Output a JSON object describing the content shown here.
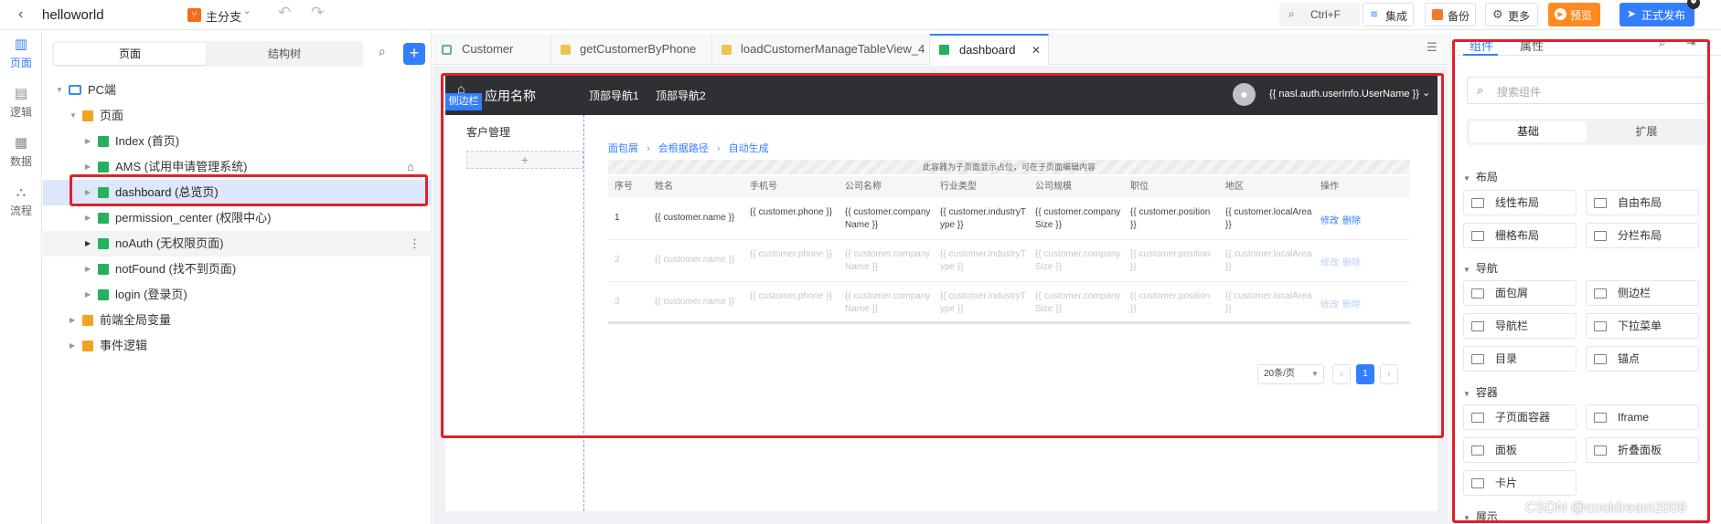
{
  "app": {
    "project_name": "helloworld",
    "branch": "主分支"
  },
  "toolbar": {
    "search_shortcut": "Ctrl+F",
    "integrate": "集成",
    "backup": "备份",
    "more": "更多",
    "preview": "预览",
    "publish": "正式发布"
  },
  "rail": {
    "items": [
      {
        "label": "页面",
        "icon": "page-icon"
      },
      {
        "label": "逻辑",
        "icon": "logic-icon"
      },
      {
        "label": "数据",
        "icon": "data-icon"
      },
      {
        "label": "流程",
        "icon": "flow-icon"
      }
    ]
  },
  "tree_panel": {
    "tabs": [
      "页面",
      "结构树"
    ],
    "nodes": [
      {
        "label": "PC端"
      },
      {
        "label": "页面"
      },
      {
        "label": "Index (首页)"
      },
      {
        "label": "AMS (试用申请管理系统)"
      },
      {
        "label": "dashboard (总览页)"
      },
      {
        "label": "permission_center (权限中心)"
      },
      {
        "label": "noAuth (无权限页面)"
      },
      {
        "label": "notFound (找不到页面)"
      },
      {
        "label": "login (登录页)"
      },
      {
        "label": "前端全局变量"
      },
      {
        "label": "事件逻辑"
      }
    ]
  },
  "editor_tabs": [
    {
      "label": "Customer"
    },
    {
      "label": "getCustomerByPhone"
    },
    {
      "label": "loadCustomerManageTableView_4"
    },
    {
      "label": "dashboard"
    }
  ],
  "canvas": {
    "app_title": "应用名称",
    "sidebar_tag": "侧边栏",
    "top_nav": [
      "顶部导航1",
      "顶部导航2"
    ],
    "username_expr": "{{ nasl.auth.userInfo.UserName }}",
    "side_menu_item": "客户管理",
    "add_symbol": "+",
    "breadcrumb": [
      "面包屑",
      "会根据路径",
      "自动生成"
    ],
    "placeholder_hint": "此容器为子页面显示占位，可在子页面编辑内容",
    "table": {
      "headers": [
        "序号",
        "姓名",
        "手机号",
        "公司名称",
        "行业类型",
        "公司规模",
        "职位",
        "地区",
        "操作"
      ],
      "rows": [
        [
          "1",
          "{{ customer.name }}",
          "{{ customer.phone }}",
          "{{ customer.companyName }}",
          "{{ customer.industryType }}",
          "{{ customer.companySize }}",
          "{{ customer.position }}",
          "{{ customer.localArea }}"
        ],
        [
          "2",
          "{{ customer.name }}",
          "{{ customer.phone }}",
          "{{ customer.companyName }}",
          "{{ customer.industryType }}",
          "{{ customer.companySize }}",
          "{{ customer.position }}",
          "{{ customer.localArea }}"
        ],
        [
          "3",
          "{{ customer.name }}",
          "{{ customer.phone }}",
          "{{ customer.companyName }}",
          "{{ customer.industryType }}",
          "{{ customer.companySize }}",
          "{{ customer.position }}",
          "{{ customer.localArea }}"
        ]
      ],
      "action_edit": "修改",
      "action_delete": "删除"
    },
    "pagination": {
      "page_size": "20条/页",
      "current_page": "1"
    }
  },
  "right_panel": {
    "tabs": [
      "组件",
      "属性"
    ],
    "search_placeholder": "搜索组件",
    "subtabs": [
      "基础",
      "扩展"
    ],
    "sections": [
      {
        "title": "布局",
        "items": [
          "线性布局",
          "自由布局",
          "栅格布局",
          "分栏布局"
        ]
      },
      {
        "title": "导航",
        "items": [
          "面包屑",
          "侧边栏",
          "导航栏",
          "下拉菜单",
          "目录",
          "锚点"
        ]
      },
      {
        "title": "容器",
        "items": [
          "子页面容器",
          "Iframe",
          "面板",
          "折叠面板",
          "卡片"
        ]
      },
      {
        "title": "展示",
        "items": []
      }
    ]
  },
  "watermark": "CSDN @cooldream2009",
  "colors": {
    "accent": "#337eff",
    "highlight": "#e0202a",
    "preview": "#ff8a1f",
    "header_dark": "#2f3033",
    "page_icon": "#26b15d",
    "folder_icon": "#f3a324"
  }
}
